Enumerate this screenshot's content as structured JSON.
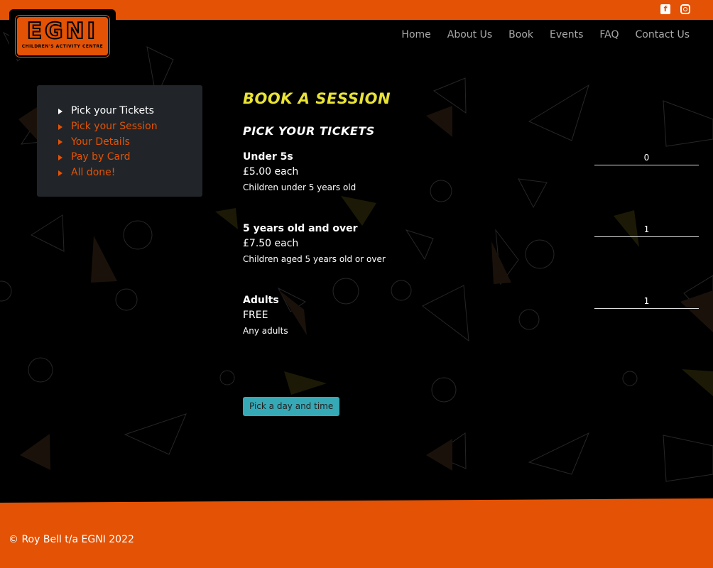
{
  "header": {
    "logo": {
      "title": "EGNI",
      "subtitle": "CHILDREN'S ACTIVITY CENTRE"
    },
    "social": [
      {
        "icon": "facebook-icon",
        "glyph": "f"
      },
      {
        "icon": "instagram-icon",
        "glyph": ""
      }
    ],
    "nav": [
      "Home",
      "About Us",
      "Book",
      "Events",
      "FAQ",
      "Contact Us"
    ]
  },
  "steps": [
    {
      "label": "Pick your Tickets",
      "active": true
    },
    {
      "label": "Pick your Session",
      "active": false
    },
    {
      "label": "Your Details",
      "active": false
    },
    {
      "label": "Pay by Card",
      "active": false
    },
    {
      "label": "All done!",
      "active": false
    }
  ],
  "main": {
    "title": "BOOK A SESSION",
    "subtitle": "PICK YOUR TICKETS",
    "tickets": [
      {
        "name": "Under 5s",
        "price": "£5.00 each",
        "description": "Children under 5 years old",
        "quantity": "0"
      },
      {
        "name": "5 years old and over",
        "price": "£7.50 each",
        "description": "Children aged 5 years old or over",
        "quantity": "1"
      },
      {
        "name": "Adults",
        "price": "FREE",
        "description": "Any adults",
        "quantity": "1"
      }
    ],
    "button": "Pick a day and time"
  },
  "colors": {
    "brand": "#e35205",
    "title": "#e9e336",
    "button": "#36a9b7",
    "panel": "#212529"
  },
  "footer": {
    "copyright": "© Roy Bell t/a EGNI 2022"
  }
}
